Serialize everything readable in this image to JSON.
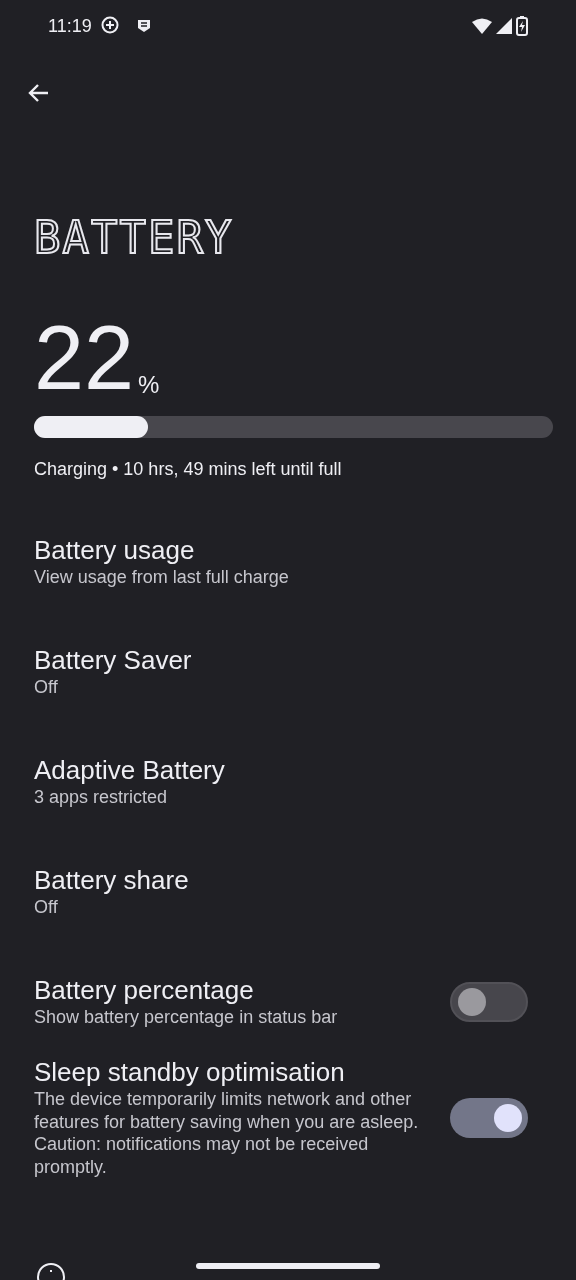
{
  "status_bar": {
    "time": "11:19"
  },
  "title": "BATTERY",
  "battery": {
    "percent": "22",
    "unit": "%",
    "level": 0.22,
    "status": "Charging • 10 hrs, 49 mins left until full"
  },
  "items": [
    {
      "kind": "link",
      "title": "Battery usage",
      "summary": "View usage from last full charge"
    },
    {
      "kind": "link",
      "title": "Battery Saver",
      "summary": "Off"
    },
    {
      "kind": "link",
      "title": "Adaptive Battery",
      "summary": "3 apps restricted"
    },
    {
      "kind": "link",
      "title": "Battery share",
      "summary": "Off"
    },
    {
      "kind": "toggle",
      "title": "Battery percentage",
      "summary": "Show battery percentage in status bar",
      "on": false
    },
    {
      "kind": "toggle",
      "title": "Sleep standby optimisation",
      "summary": "The device temporarily limits network and other features for battery saving when you are asleep. Caution: notifications may not be received promptly.",
      "on": true
    }
  ]
}
